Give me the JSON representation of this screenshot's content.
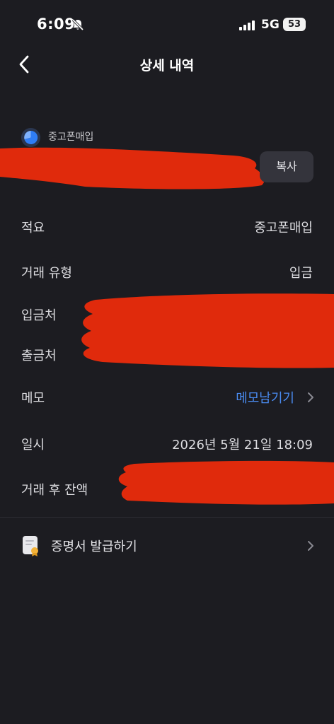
{
  "status_bar": {
    "time": "6:09",
    "network": "5G",
    "battery": "53"
  },
  "header": {
    "title": "상세 내역"
  },
  "merchant": {
    "name": "중고폰매입",
    "copy_label": "복사"
  },
  "details": {
    "summary_label": "적요",
    "summary_value": "중고폰매입",
    "type_label": "거래 유형",
    "type_value": "입금",
    "depositor_label": "입금처",
    "withdrawer_label": "출금처",
    "memo_label": "메모",
    "memo_action": "메모남기기",
    "datetime_label": "일시",
    "datetime_value": "2026년 5월 21일 18:09",
    "balance_label": "거래 후 잔액"
  },
  "certificate": {
    "label": "증명서 발급하기"
  },
  "colors": {
    "background": "#1c1c21",
    "accent_link": "#4a8cf2",
    "redaction": "#e02a0c",
    "button_bg": "#34343c"
  }
}
